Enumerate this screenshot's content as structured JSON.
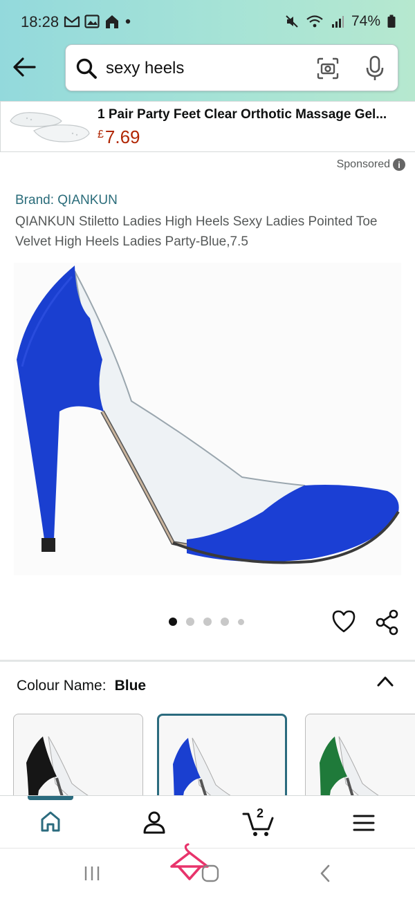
{
  "status_bar": {
    "time": "18:28",
    "battery": "74%"
  },
  "search": {
    "query": "sexy heels"
  },
  "sponsored_product": {
    "title": "1 Pair Party Feet Clear Orthotic Massage Gel...",
    "currency": "£",
    "price": "7.69",
    "label": "Sponsored",
    "info_glyph": "i"
  },
  "product": {
    "brand": "Brand: QIANKUN",
    "title": "QIANKUN Stiletto Ladies High Heels Sexy Ladies Pointed Toe Velvet High Heels Ladies Party-Blue,7.5",
    "image_count": 5,
    "active_image": 1
  },
  "colour": {
    "label": "Colour Name:",
    "value": "Blue",
    "swatches": [
      "black",
      "blue",
      "green"
    ],
    "selected": "blue"
  },
  "bottom_nav": {
    "items": [
      "home",
      "account",
      "cart",
      "menu"
    ],
    "cart_count": "2",
    "active": "home"
  },
  "colors": {
    "accent": "#2b6b7e",
    "price": "#b12704",
    "link": "#2a6c7a",
    "shoe_blue": "#1a3fd0"
  }
}
